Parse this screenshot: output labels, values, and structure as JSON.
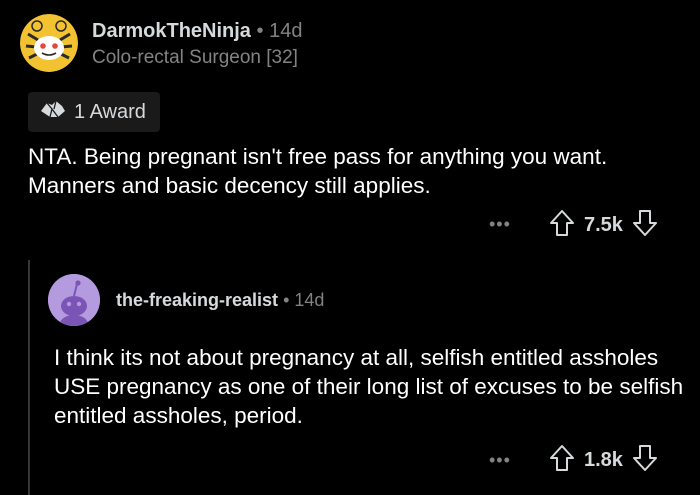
{
  "comment": {
    "username": "DarmokTheNinja",
    "separator": "•",
    "age": "14d",
    "flair": "Colo-rectal Surgeon [32]",
    "award_text": "1 Award",
    "body": "NTA. Being pregnant isn't free pass for anything you want. Manners and basic decency still applies.",
    "more": "•••",
    "votes": "7.5k"
  },
  "reply": {
    "username": "the-freaking-realist",
    "separator": "•",
    "age": "14d",
    "body": "I think its not about pregnancy at all, selfish entitled assholes USE pregnancy as one of their long list of excuses to be selfish entitled assholes, period.",
    "more": "•••",
    "votes": "1.8k"
  },
  "icons": {
    "avatar_main": "tiger-snoo-avatar",
    "award": "award-icon",
    "upvote": "upvote-arrow-icon",
    "downvote": "downvote-arrow-icon",
    "avatar_reply": "default-snoo-avatar"
  },
  "colors": {
    "background": "#000000",
    "text_primary": "#ffffff",
    "text_secondary": "#818384",
    "reply_avatar": "#b49adf"
  }
}
